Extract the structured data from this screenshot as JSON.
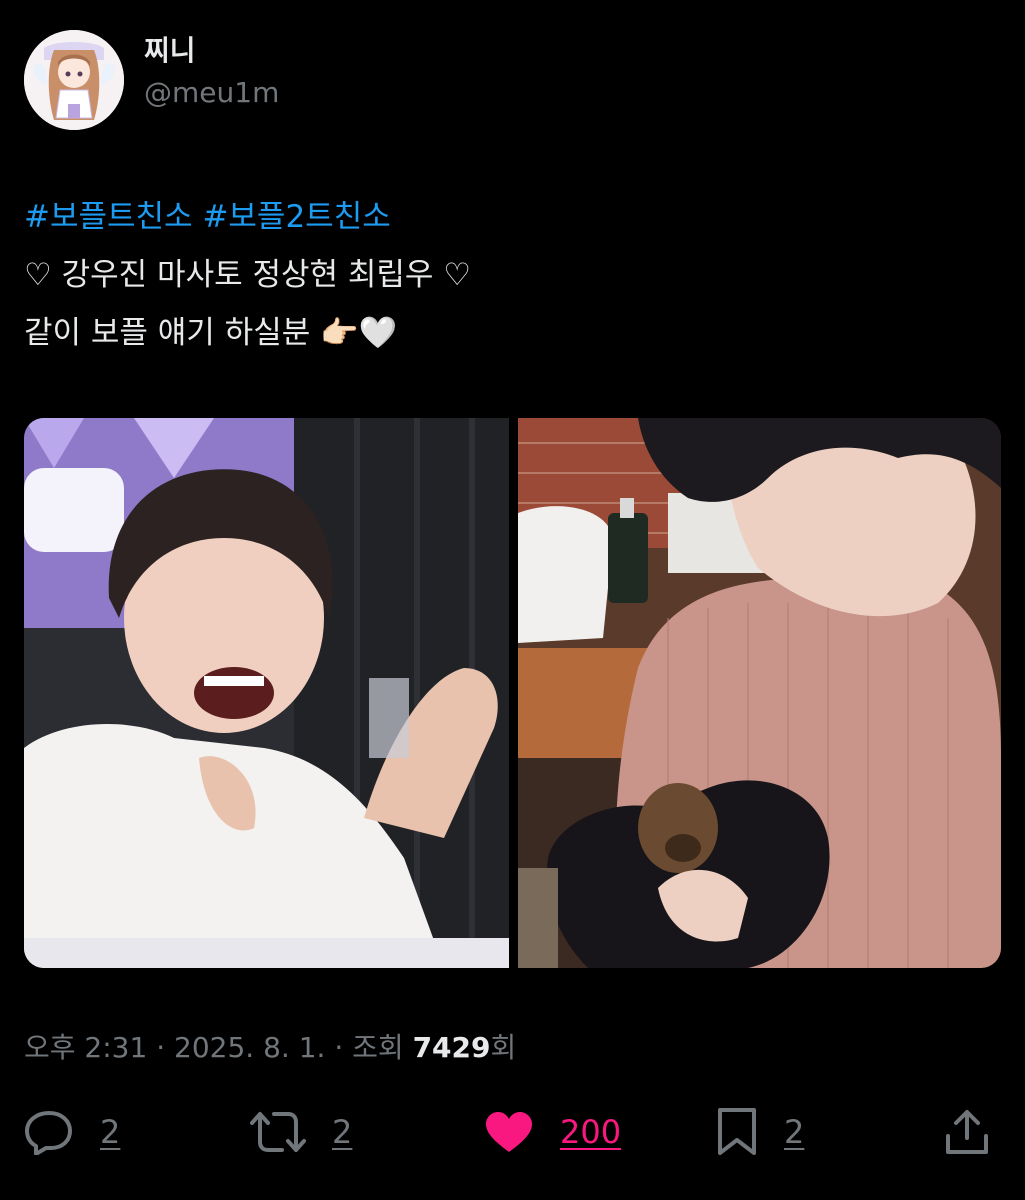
{
  "user": {
    "display_name": "찌니",
    "handle": "@meu1m",
    "avatar_icon": "avatar-anime-girl"
  },
  "tweet": {
    "hashtags": [
      "#보플트친소",
      "#보플2트친소"
    ],
    "line2": "♡ 강우진 마사토 정상현 최립우 ♡",
    "line3": "같이 보플 얘기 하실분 👉🏻🤍"
  },
  "meta": {
    "time": "오후 2:31",
    "separator": "·",
    "date": "2025. 8. 1.",
    "views_label": "조회",
    "views_count": "7429",
    "views_suffix": "회"
  },
  "actions": {
    "reply_count": "2",
    "retweet_count": "2",
    "like_count": "200",
    "bookmark_count": "2"
  },
  "colors": {
    "background": "#000000",
    "text": "#e7e9ea",
    "secondary": "#71767b",
    "hashtag": "#1d9bf0",
    "like": "#f91880"
  }
}
